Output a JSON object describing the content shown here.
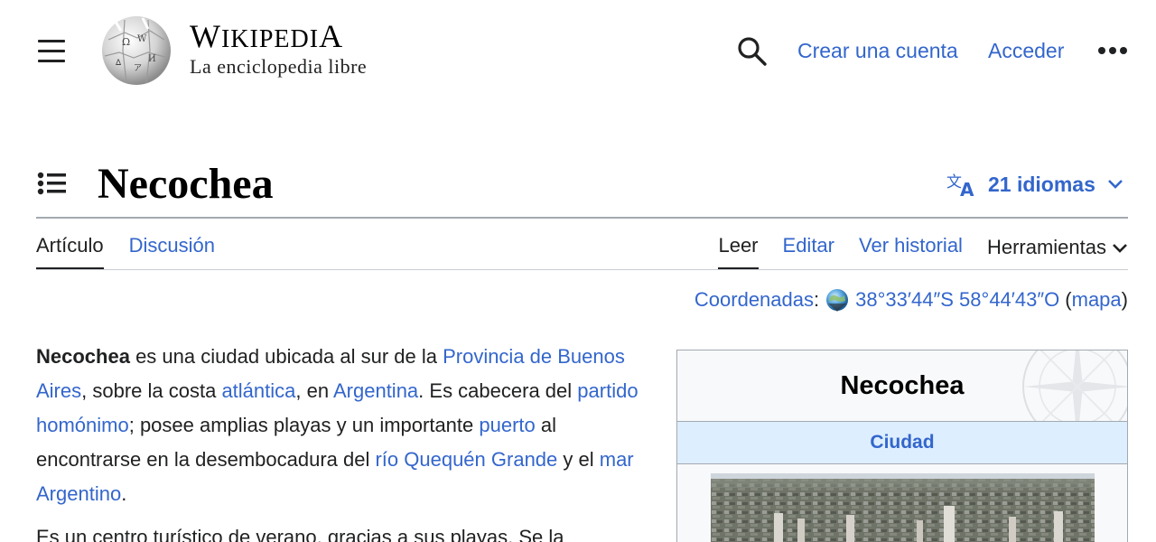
{
  "header": {
    "wordmark_first": "W",
    "wordmark_mid": "IKIPEDI",
    "wordmark_last": "A",
    "tagline": "La enciclopedia libre",
    "create_account": "Crear una cuenta",
    "login": "Acceder"
  },
  "page": {
    "title": "Necochea",
    "languages": "21 idiomas"
  },
  "tabs": {
    "article": "Artículo",
    "discussion": "Discusión",
    "read": "Leer",
    "edit": "Editar",
    "history": "Ver historial",
    "tools": "Herramientas"
  },
  "coords": {
    "label": "Coordenadas",
    "colon": ":",
    "value": "38°33′44″S 58°44′43″O",
    "open_paren": "(",
    "map": "mapa",
    "close_paren": ")"
  },
  "article": {
    "p1": {
      "subject": "Necochea",
      "t1": " es una ciudad ubicada al sur de la ",
      "l1": "Provincia de Buenos Aires",
      "t2": ", sobre la costa ",
      "l2": "atlántica",
      "t3": ", en ",
      "l3": "Argentina",
      "t4": ". Es cabecera del ",
      "l4": "partido homónimo",
      "t5": "; posee amplias playas y un importante ",
      "l5": "puerto",
      "t6": " al encontrarse en la desembocadura del ",
      "l6": "río Quequén Grande",
      "t7": " y el ",
      "l7": "mar Argentino",
      "t8": "."
    },
    "p2": "Es un centro turístico de verano, gracias a sus playas. Se la"
  },
  "infobox": {
    "title": "Necochea",
    "type": "Ciudad"
  },
  "colors": {
    "link": "#3366cc",
    "text": "#202122",
    "infobox_header": "#ddeeff",
    "border": "#a2a9b1"
  },
  "icons": {
    "menu": "hamburger-icon",
    "search": "search-icon",
    "more": "ellipsis-icon",
    "toc": "toc-icon",
    "language": "language-icon",
    "chevron": "chevron-down-icon",
    "globe": "globe-icon"
  }
}
